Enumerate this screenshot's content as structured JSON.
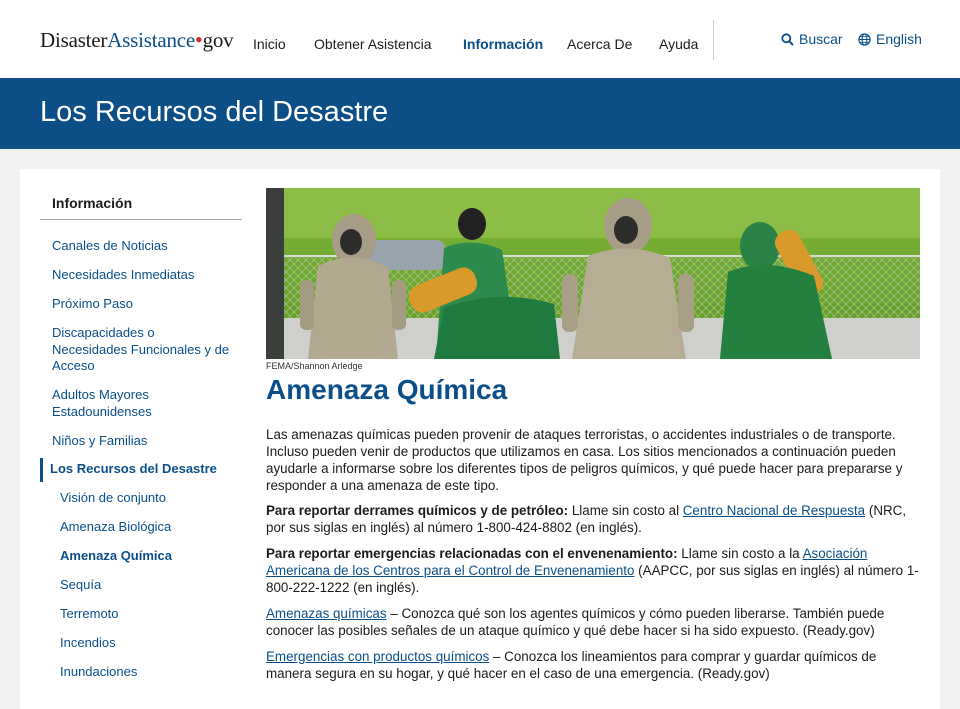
{
  "header": {
    "logo_part1": "Disaster",
    "logo_part2": "Assistance",
    "logo_dot": "•",
    "logo_part3": "gov",
    "nav": [
      "Inicio",
      "Obtener Asistencia",
      "Información",
      "Acerca De",
      "Ayuda"
    ],
    "active_nav": "Información",
    "search_label": "Buscar",
    "language_label": "English",
    "search_icon": "search-icon",
    "language_icon": "globe-icon"
  },
  "banner": {
    "title": "Los Recursos del Desastre"
  },
  "sidebar": {
    "heading": "Información",
    "items": [
      "Canales de Noticias",
      "Necesidades Inmediatas",
      "Próximo Paso",
      "Discapacidades o Necesidades Funcionales y de Acceso",
      "Adultos Mayores Estadounidenses",
      "Niños y Familias",
      "Los Recursos del Desastre"
    ],
    "subitems": [
      "Visión de conjunto",
      "Amenaza Biológica",
      "Amenaza Química",
      "Sequía",
      "Terremoto",
      "Incendios",
      "Inundaciones"
    ],
    "current_item": "Los Recursos del Desastre",
    "current_subitem": "Amenaza Química"
  },
  "main": {
    "image_caption": "FEMA/Shannon Arledge",
    "title": "Amenaza Química",
    "intro": "Las amenazas químicas pueden provenir de ataques terroristas, o accidentes industriales o de transporte. Incluso pueden venir de productos que utilizamos en casa. Los sitios mencionados a continuación pueden ayudarle a informarse sobre los diferentes tipos de peligros químicos, y qué puede hacer para prepararse y responder a una amenaza de este tipo.",
    "spill": {
      "label": "Para reportar derrames químicos y de petróleo:",
      "text1": " Llame sin costo al ",
      "link": "Centro Nacional de Respuesta",
      "text2": " (NRC, por sus siglas en inglés) al número 1-800-424-8802 (en inglés)."
    },
    "poison": {
      "label": "Para reportar emergencias relacionadas con el envenenamiento:",
      "text1": " Llame sin costo a la ",
      "link": "Asociación Americana de los Centros para el Control de Envenenamiento",
      "text2": " (AAPCC, por sus siglas en inglés) al número 1-800-222-1222 (en inglés)."
    },
    "threats": {
      "link": "Amenazas químicas",
      "text": " – Conozca qué son los agentes químicos y cómo pueden liberarse. También puede conocer las posibles señales de un ataque químico y qué debe hacer si ha sido expuesto. (Ready.gov)"
    },
    "products": {
      "link": "Emergencias con productos químicos",
      "text": " – Conozca los lineamientos para comprar y guardar químicos de manera segura en su hogar, y qué hacer en el caso de una emergencia. (Ready.gov)"
    }
  },
  "colors": {
    "brand_blue": "#0c4e86",
    "link_blue": "#0b4f8a",
    "logo_dot_red": "#d62828"
  }
}
